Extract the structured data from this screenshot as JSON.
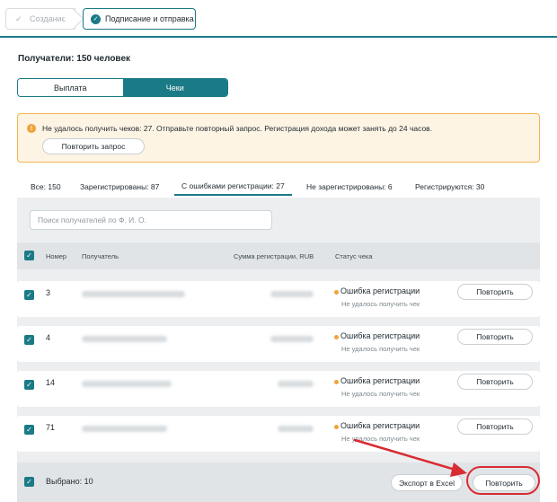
{
  "stepper": {
    "step1": "Создание",
    "step2": "Подписание и отправка"
  },
  "recipients_title": "Получатели: 150 человек",
  "segment": {
    "left": "Выплата",
    "right": "Чеки"
  },
  "banner": {
    "message": "Не удалось получить чеков: 27. Отправьте повторный запрос. Регистрация дохода может занять до 24 часов.",
    "button": "Повторить запрос"
  },
  "tabs": [
    {
      "label": "Все: 150"
    },
    {
      "label": "Зарегистрированы: 87"
    },
    {
      "label": "С ошибками регистрации: 27"
    },
    {
      "label": "Не зарегистрированы: 6"
    },
    {
      "label": "Регистрируются: 30"
    }
  ],
  "search": {
    "placeholder": "Поиск получателей по Ф. И. О."
  },
  "columns": {
    "number": "Номер",
    "recipient": "Получатель",
    "amount": "Сумма регистрации, RUB",
    "status": "Статус чека"
  },
  "rows": [
    {
      "num": "3",
      "status": "Ошибка регистрации",
      "substatus": "Не удалось получить чек",
      "action": "Повторить"
    },
    {
      "num": "4",
      "status": "Ошибка регистрации",
      "substatus": "Не удалось получить чек",
      "action": "Повторить"
    },
    {
      "num": "14",
      "status": "Ошибка регистрации",
      "substatus": "Не удалось получить чек",
      "action": "Повторить"
    },
    {
      "num": "71",
      "status": "Ошибка регистрации",
      "substatus": "Не удалось получить чек",
      "action": "Повторить"
    }
  ],
  "footer": {
    "selected": "Выбрано: 10",
    "export": "Экспорт в Excel",
    "retry": "Повторить"
  },
  "colors": {
    "accent": "#1a7a86",
    "warning": "#f0a33a",
    "highlight": "#d92b32"
  }
}
